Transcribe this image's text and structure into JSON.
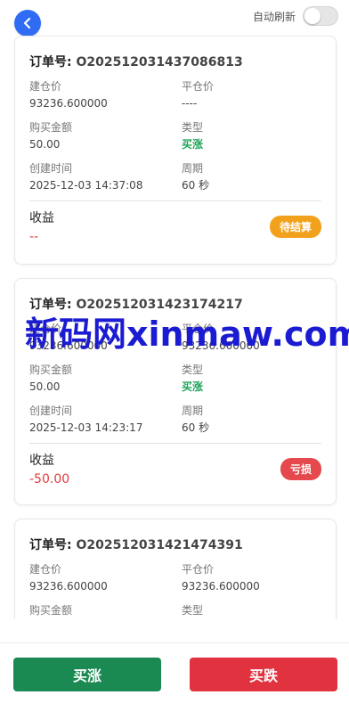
{
  "header": {
    "auto_refresh_label": "自动刷新",
    "auto_refresh_on": false
  },
  "orders": [
    {
      "order_label": "订单号:",
      "order_no": "O202512031437086813",
      "open_price_label": "建仓价",
      "open_price": "93236.600000",
      "close_price_label": "平仓价",
      "close_price": "----",
      "amount_label": "购买金额",
      "amount": "50.00",
      "type_label": "类型",
      "type": "买涨",
      "created_label": "创建时间",
      "created": "2025-12-03 14:37:08",
      "period_label": "周期",
      "period": "60 秒",
      "profit_label": "收益",
      "profit": "--",
      "status": "待结算"
    },
    {
      "order_label": "订单号:",
      "order_no": "O202512031423174217",
      "open_price_label": "建仓价",
      "open_price": "93236.600000",
      "close_price_label": "平仓价",
      "close_price": "93236.600000",
      "amount_label": "购买金额",
      "amount": "50.00",
      "type_label": "类型",
      "type": "买涨",
      "created_label": "创建时间",
      "created": "2025-12-03 14:23:17",
      "period_label": "周期",
      "period": "60 秒",
      "profit_label": "收益",
      "profit": "-50.00",
      "status": "亏损"
    },
    {
      "order_label": "订单号:",
      "order_no": "O202512031421474391",
      "open_price_label": "建仓价",
      "open_price": "93236.600000",
      "close_price_label": "平仓价",
      "close_price": "93236.600000",
      "amount_label": "购买金额",
      "type_label": "类型"
    }
  ],
  "watermark": "新码网xinmaw.com",
  "actions": {
    "buy_up": "买涨",
    "buy_down": "买跌"
  },
  "colors": {
    "accent_blue": "#2f6cf3",
    "up_green": "#1fa55a",
    "loss_red": "#e53a3a",
    "pending_orange": "#f2a11c",
    "buy_up_bg": "#1b8a52",
    "buy_down_bg": "#e0323f"
  }
}
